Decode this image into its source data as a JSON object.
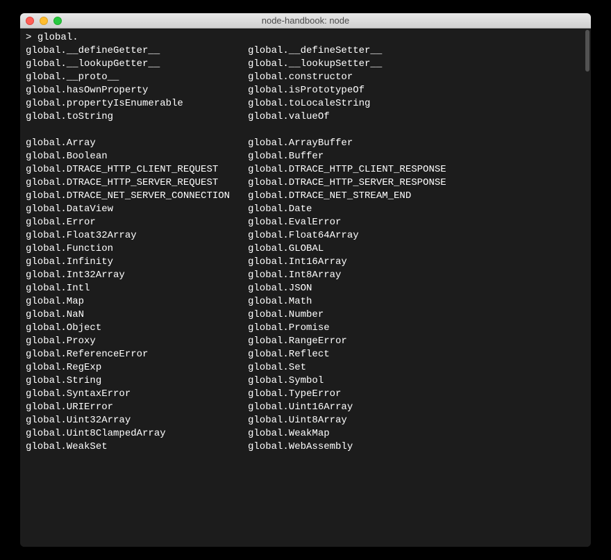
{
  "window": {
    "title": "node-handbook: node"
  },
  "prompt": {
    "prefix": "> ",
    "input": "global."
  },
  "completion_groups": [
    {
      "rows": [
        {
          "left": "global.__defineGetter__",
          "right": "global.__defineSetter__"
        },
        {
          "left": "global.__lookupGetter__",
          "right": "global.__lookupSetter__"
        },
        {
          "left": "global.__proto__",
          "right": "global.constructor"
        },
        {
          "left": "global.hasOwnProperty",
          "right": "global.isPrototypeOf"
        },
        {
          "left": "global.propertyIsEnumerable",
          "right": "global.toLocaleString"
        },
        {
          "left": "global.toString",
          "right": "global.valueOf"
        }
      ]
    },
    {
      "rows": [
        {
          "left": "global.Array",
          "right": "global.ArrayBuffer"
        },
        {
          "left": "global.Boolean",
          "right": "global.Buffer"
        },
        {
          "left": "global.DTRACE_HTTP_CLIENT_REQUEST",
          "right": "global.DTRACE_HTTP_CLIENT_RESPONSE"
        },
        {
          "left": "global.DTRACE_HTTP_SERVER_REQUEST",
          "right": "global.DTRACE_HTTP_SERVER_RESPONSE"
        },
        {
          "left": "global.DTRACE_NET_SERVER_CONNECTION",
          "right": "global.DTRACE_NET_STREAM_END"
        },
        {
          "left": "global.DataView",
          "right": "global.Date"
        },
        {
          "left": "global.Error",
          "right": "global.EvalError"
        },
        {
          "left": "global.Float32Array",
          "right": "global.Float64Array"
        },
        {
          "left": "global.Function",
          "right": "global.GLOBAL"
        },
        {
          "left": "global.Infinity",
          "right": "global.Int16Array"
        },
        {
          "left": "global.Int32Array",
          "right": "global.Int8Array"
        },
        {
          "left": "global.Intl",
          "right": "global.JSON"
        },
        {
          "left": "global.Map",
          "right": "global.Math"
        },
        {
          "left": "global.NaN",
          "right": "global.Number"
        },
        {
          "left": "global.Object",
          "right": "global.Promise"
        },
        {
          "left": "global.Proxy",
          "right": "global.RangeError"
        },
        {
          "left": "global.ReferenceError",
          "right": "global.Reflect"
        },
        {
          "left": "global.RegExp",
          "right": "global.Set"
        },
        {
          "left": "global.String",
          "right": "global.Symbol"
        },
        {
          "left": "global.SyntaxError",
          "right": "global.TypeError"
        },
        {
          "left": "global.URIError",
          "right": "global.Uint16Array"
        },
        {
          "left": "global.Uint32Array",
          "right": "global.Uint8Array"
        },
        {
          "left": "global.Uint8ClampedArray",
          "right": "global.WeakMap"
        },
        {
          "left": "global.WeakSet",
          "right": "global.WebAssembly"
        }
      ]
    }
  ]
}
